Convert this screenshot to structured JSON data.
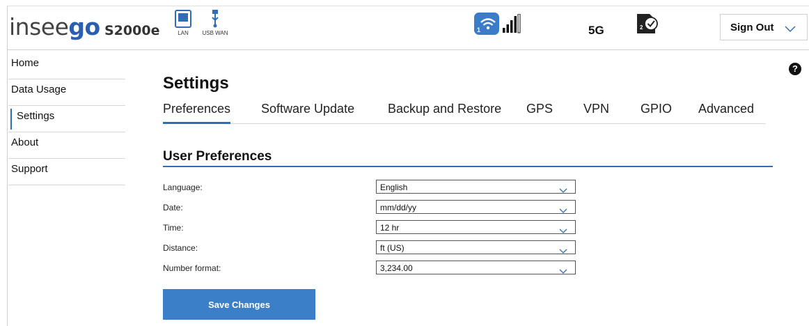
{
  "header": {
    "brand_prefix": "insee",
    "brand_suffix": "go",
    "model": "S2000e",
    "ports": {
      "lan_label": "LAN",
      "usb_label": "USB WAN"
    },
    "wifi_band": "1",
    "network_type": "5G",
    "sim_slot": "2",
    "sign_out_label": "Sign Out",
    "colors": {
      "accent": "#2f6db7",
      "button": "#3b7fc9"
    }
  },
  "sidebar": {
    "items": [
      {
        "label": "Home"
      },
      {
        "label": "Data Usage"
      },
      {
        "label": "Settings"
      },
      {
        "label": "About"
      },
      {
        "label": "Support"
      }
    ],
    "active_index": 2
  },
  "main": {
    "help_symbol": "?",
    "title": "Settings",
    "tabs": [
      {
        "label": "Preferences"
      },
      {
        "label": "Software Update"
      },
      {
        "label": "Backup and Restore"
      },
      {
        "label": "GPS"
      },
      {
        "label": "VPN"
      },
      {
        "label": "GPIO"
      },
      {
        "label": "Advanced"
      }
    ],
    "active_tab": 0,
    "section_title": "User Preferences",
    "fields": [
      {
        "label": "Language:",
        "value": "English"
      },
      {
        "label": "Date:",
        "value": "mm/dd/yy"
      },
      {
        "label": "Time:",
        "value": "12 hr"
      },
      {
        "label": "Distance:",
        "value": "ft (US)"
      },
      {
        "label": "Number format:",
        "value": "3,234.00"
      }
    ],
    "save_label": "Save Changes"
  }
}
